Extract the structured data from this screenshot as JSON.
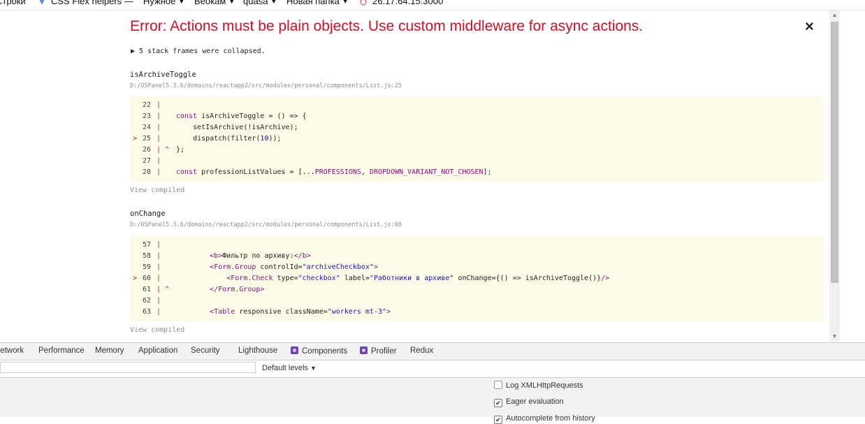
{
  "bookmarks": [
    {
      "label": "Строки",
      "has_caret": false
    },
    {
      "label": "CSS Flex helpers —",
      "has_caret": false,
      "icon": "css-flex-icon"
    },
    {
      "label": "Нужное",
      "has_caret": true
    },
    {
      "label": "Веокам",
      "has_caret": true
    },
    {
      "label": "quasa",
      "has_caret": true
    },
    {
      "label": "Новая папка",
      "has_caret": true
    },
    {
      "label": "26.17.64.15:3000",
      "has_caret": false,
      "icon": "site-icon"
    }
  ],
  "overlay": {
    "error_title": "Error: Actions must be plain objects. Use custom middleware for async actions.",
    "close_symbol": "×",
    "collapsed_text": "▶ 5 stack frames were collapsed.",
    "view_compiled_label": "View compiled",
    "frames": [
      {
        "name": "isArchiveToggle",
        "path": "D:/OSPanel5.3.6/domains/reactapp2/src/modules/personal/components/List.js:25",
        "lines": [
          {
            "num": "22",
            "marker": "",
            "gutter": "|",
            "code": ""
          },
          {
            "num": "23",
            "marker": "",
            "gutter": "|",
            "code": "const isArchiveToggle = () => {"
          },
          {
            "num": "24",
            "marker": "",
            "gutter": "|",
            "code": "    setIsArchive(!isArchive);"
          },
          {
            "num": "25",
            "marker": ">",
            "gutter": "|",
            "code": "    dispatch(filter(10));"
          },
          {
            "num": "26",
            "marker": "",
            "gutter": "| ^",
            "code": "};"
          },
          {
            "num": "27",
            "marker": "",
            "gutter": "|",
            "code": ""
          },
          {
            "num": "28",
            "marker": "",
            "gutter": "|",
            "code": "const professionListValues = [...PROFESSIONS, DROPDOWN_VARIANT_NOT_CHOSEN];"
          }
        ]
      },
      {
        "name": "onChange",
        "path": "D:/OSPanel5.3.6/domains/reactapp2/src/modules/personal/components/List.js:60",
        "lines": [
          {
            "num": "57",
            "marker": "",
            "gutter": "|",
            "code": ""
          },
          {
            "num": "58",
            "marker": "",
            "gutter": "|",
            "code": "        <b>Фильтр по архиву:</b>"
          },
          {
            "num": "59",
            "marker": "",
            "gutter": "|",
            "code": "        <Form.Group controlId=\"archiveCheckbox\">"
          },
          {
            "num": "60",
            "marker": ">",
            "gutter": "|",
            "code": "            <Form.Check type=\"checkbox\" label=\"Работники в архиве\" onChange={() => isArchiveToggle()}/>"
          },
          {
            "num": "61",
            "marker": "",
            "gutter": "| ^",
            "code": "        </Form.Group>"
          },
          {
            "num": "62",
            "marker": "",
            "gutter": "|",
            "code": ""
          },
          {
            "num": "63",
            "marker": "",
            "gutter": "|",
            "code": "        <Table responsive className=\"workers mt-3\">"
          }
        ]
      }
    ]
  },
  "devtools": {
    "tabs": [
      {
        "label": "Network",
        "icon": null
      },
      {
        "label": "Performance",
        "icon": null
      },
      {
        "label": "Memory",
        "icon": null
      },
      {
        "label": "Application",
        "icon": null
      },
      {
        "label": "Security",
        "icon": null
      },
      {
        "label": "Lighthouse",
        "icon": null
      },
      {
        "label": "Components",
        "icon": "react-components-icon"
      },
      {
        "label": "Profiler",
        "icon": "react-profiler-icon"
      },
      {
        "label": "Redux",
        "icon": null
      }
    ],
    "filter_value": "",
    "levels_label": "Default levels",
    "settings": [
      {
        "label": "Log XMLHttpRequests",
        "checked": false
      },
      {
        "label": "Eager evaluation",
        "checked": true
      },
      {
        "label": "Autocomplete from history",
        "checked": true
      }
    ]
  },
  "colors": {
    "error_red": "#ce1126",
    "code_bg": "#fcfbe7",
    "path_gray": "#878e91"
  }
}
